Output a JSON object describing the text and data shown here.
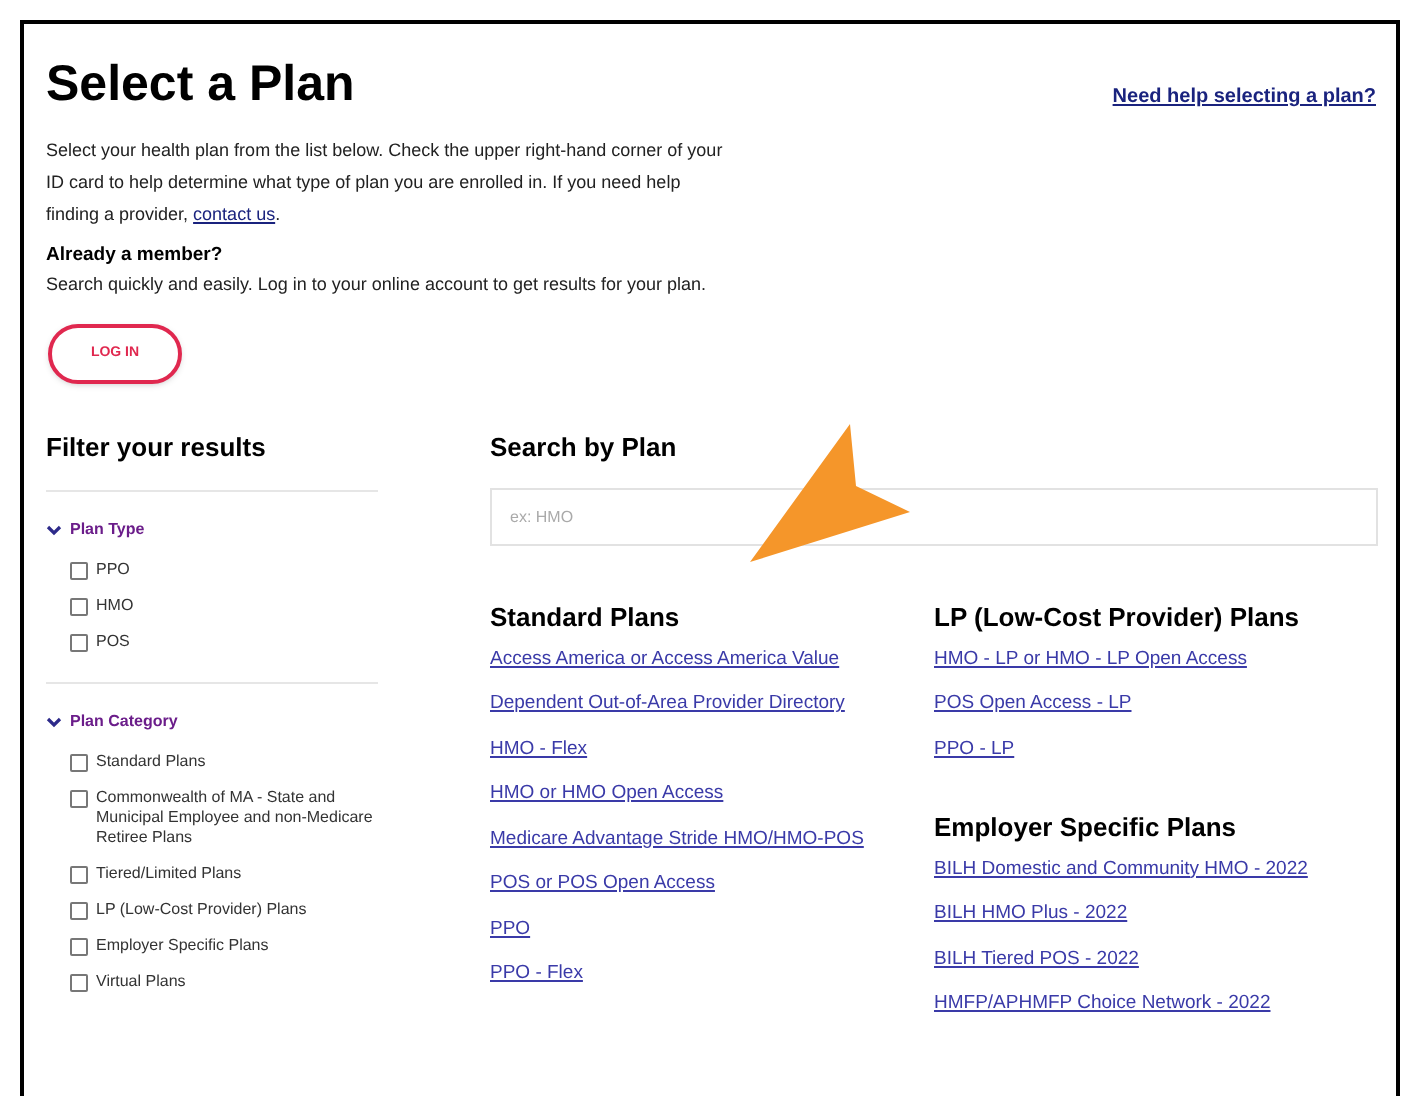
{
  "title": "Select a Plan",
  "help_link": "Need help selecting a plan?",
  "intro": {
    "text": "Select your health plan from the list below. Check the upper right-hand corner of your ID card to help determine what type of plan you are enrolled in. If you need help finding a provider, ",
    "link": "contact us",
    "end": "."
  },
  "member": {
    "heading": "Already a member?",
    "text": "Search quickly and easily. Log in to your online account to get results for your plan.",
    "button": "LOG IN"
  },
  "filters": {
    "title": "Filter your results",
    "groups": [
      {
        "label": "Plan Type",
        "expanded": true,
        "options": [
          {
            "label": "PPO",
            "checked": false
          },
          {
            "label": "HMO",
            "checked": false
          },
          {
            "label": "POS",
            "checked": false
          }
        ]
      },
      {
        "label": "Plan Category",
        "expanded": true,
        "options": [
          {
            "label": "Standard Plans",
            "checked": false
          },
          {
            "label": "Commonwealth of MA - State and Municipal Employee and non-Medicare Retiree Plans",
            "checked": false
          },
          {
            "label": "Tiered/Limited Plans",
            "checked": false
          },
          {
            "label": "LP (Low-Cost Provider) Plans",
            "checked": false
          },
          {
            "label": "Employer Specific Plans",
            "checked": false
          },
          {
            "label": "Virtual Plans",
            "checked": false
          }
        ]
      }
    ]
  },
  "search": {
    "title": "Search by Plan",
    "placeholder": "ex: HMO"
  },
  "plan_columns": [
    {
      "sections": [
        {
          "title": "Standard Plans",
          "links": [
            "Access America or Access America Value",
            "Dependent Out-of-Area Provider Directory",
            "HMO - Flex",
            "HMO or HMO Open Access",
            "Medicare Advantage Stride HMO/HMO-POS",
            "POS or POS Open Access",
            "PPO",
            "PPO - Flex"
          ]
        }
      ]
    },
    {
      "sections": [
        {
          "title": "LP (Low-Cost Provider) Plans",
          "links": [
            "HMO - LP or HMO - LP Open Access",
            "POS Open Access - LP",
            "PPO - LP"
          ]
        },
        {
          "title": "Employer Specific Plans",
          "links": [
            "BILH Domestic and Community HMO - 2022",
            "BILH HMO Plus - 2022",
            "BILH Tiered POS - 2022",
            "HMFP/APHMFP Choice Network - 2022"
          ]
        }
      ]
    }
  ]
}
